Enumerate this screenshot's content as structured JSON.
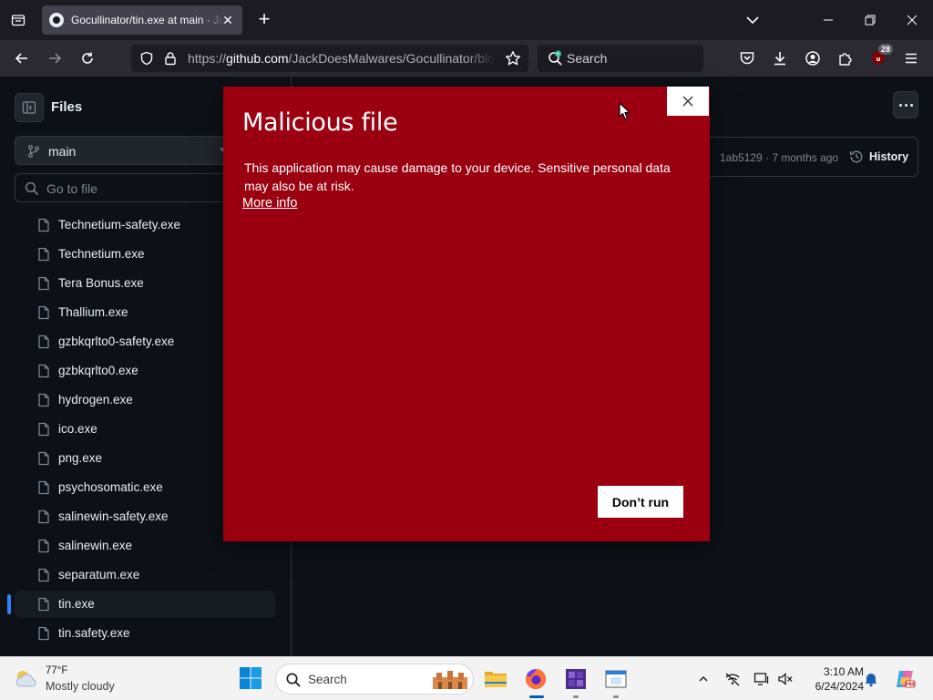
{
  "browser": {
    "tab_title": "Gocullinator/tin.exe at main · JackDoesMalwares/Gocullinator",
    "url_prefix": "https://",
    "url_host": "github.com",
    "url_path": "/JackDoesMalwares/Gocullinator/blob/main/tin.exe",
    "search_placeholder": "Search",
    "extensions_badge": "28"
  },
  "github": {
    "files_title": "Files",
    "branch": "main",
    "goto_placeholder": "Go to file",
    "files": [
      {
        "name": "Technetium-safety.exe",
        "selected": false
      },
      {
        "name": "Technetium.exe",
        "selected": false
      },
      {
        "name": "Tera Bonus.exe",
        "selected": false
      },
      {
        "name": "Thallium.exe",
        "selected": false
      },
      {
        "name": "gzbkqrlto0-safety.exe",
        "selected": false
      },
      {
        "name": "gzbkqrlto0.exe",
        "selected": false
      },
      {
        "name": "hydrogen.exe",
        "selected": false
      },
      {
        "name": "ico.exe",
        "selected": false
      },
      {
        "name": "png.exe",
        "selected": false
      },
      {
        "name": "psychosomatic.exe",
        "selected": false
      },
      {
        "name": "salinewin-safety.exe",
        "selected": false
      },
      {
        "name": "salinewin.exe",
        "selected": false
      },
      {
        "name": "separatum.exe",
        "selected": false
      },
      {
        "name": "tin.exe",
        "selected": true
      },
      {
        "name": "tin.safety.exe",
        "selected": false
      }
    ],
    "commit_meta": "1ab5129 · 7 months ago",
    "history_label": "History"
  },
  "dialog": {
    "title": "Malicious file",
    "message": "This application may cause damage to your device. Sensitive personal data may also be at risk.",
    "more_info": "More info",
    "dont_run": "Don’t run",
    "background_color": "#9a0010"
  },
  "taskbar": {
    "temperature": "77°F",
    "condition": "Mostly cloudy",
    "search_placeholder": "Search",
    "time": "3:10 AM",
    "date": "6/24/2024"
  },
  "icons": [
    "tab-list-icon",
    "github-favicon",
    "close-icon",
    "plus-icon",
    "chevron-down-icon",
    "minimize-icon",
    "restore-icon",
    "back-arrow-icon",
    "forward-arrow-icon",
    "reload-icon",
    "shield-icon",
    "lock-icon",
    "star-icon",
    "search-icon",
    "pocket-icon",
    "download-icon",
    "account-icon",
    "extensions-icon",
    "ublock-icon",
    "menu-icon",
    "sidebar-toggle-icon",
    "git-branch-icon",
    "file-icon",
    "history-icon",
    "kebab-menu-icon",
    "weather-cloud-icon",
    "windows-start-icon",
    "file-explorer-icon",
    "firefox-icon",
    "wifi-off-icon",
    "notification-bell-icon",
    "copilot-icon"
  ]
}
